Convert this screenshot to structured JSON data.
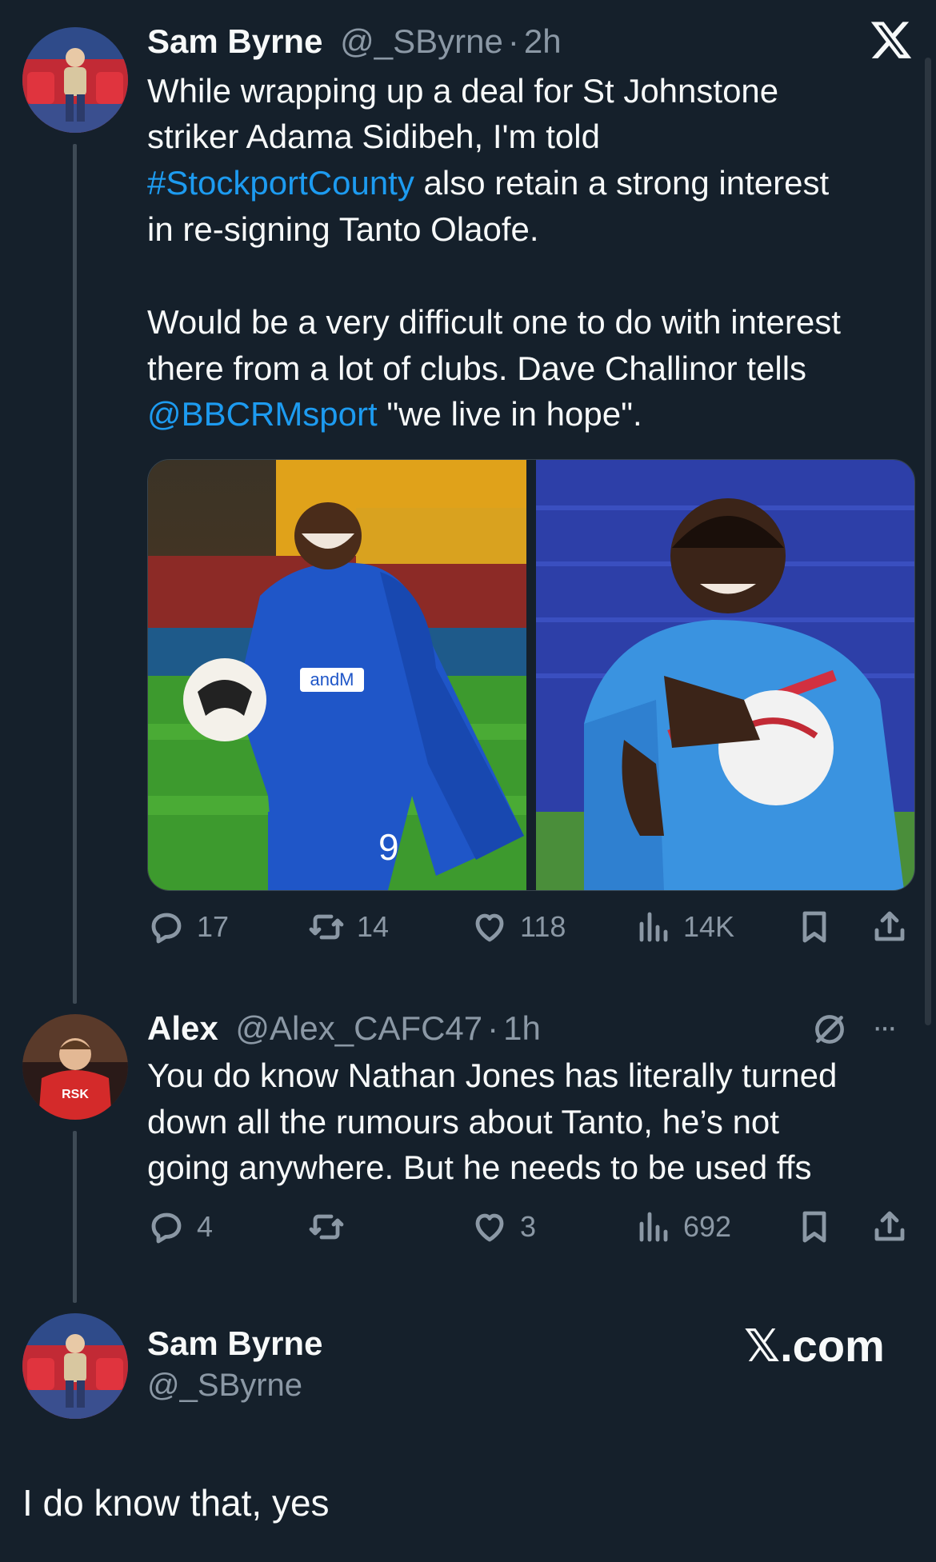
{
  "brand": {
    "x_logo": "𝕏",
    "x_com": "𝕏.com"
  },
  "tweet1": {
    "name": "Sam Byrne",
    "handle": "@_SByrne",
    "sep": "·",
    "time": "2h",
    "line1": "While wrapping up a deal for St Johnstone",
    "line2": "striker Adama Sidibeh, I'm told",
    "hashtag": "#StockportCounty",
    "line3_rest": " also retain a strong interest",
    "line4": "in re-signing Tanto Olaofe.",
    "line5": "Would be a very difficult one to do with interest",
    "line6": "there from a lot of clubs. Dave Challinor tells",
    "mention": "@BBCRMsport",
    "line7_rest": " \"we live in hope\".",
    "photo1_text": "andM",
    "photo1_number": "9",
    "replies": "17",
    "reposts": "14",
    "likes": "118",
    "views": "14K"
  },
  "tweet2": {
    "name": "Alex",
    "handle": "@Alex_CAFC47",
    "sep": "·",
    "time": "1h",
    "line1": "You do know Nathan Jones has literally turned",
    "line2": "down all the rumours about Tanto, he’s not",
    "line3": "going anywhere. But he needs to be used ffs",
    "avatar_text": "RSK",
    "more": "···",
    "replies": "4",
    "reposts": "",
    "likes": "3",
    "views": "692"
  },
  "tweet3": {
    "name": "Sam Byrne",
    "handle": "@_SByrne",
    "text": "I do know that, yes"
  },
  "icons": [
    "x-logo-icon",
    "reply-icon",
    "repost-icon",
    "like-icon",
    "views-icon",
    "bookmark-icon",
    "share-icon",
    "grok-icon",
    "more-icon"
  ],
  "colors": {
    "background": "#15202b",
    "link": "#1d9bf0",
    "muted": "#8b98a5",
    "text": "#f7f9f9"
  }
}
